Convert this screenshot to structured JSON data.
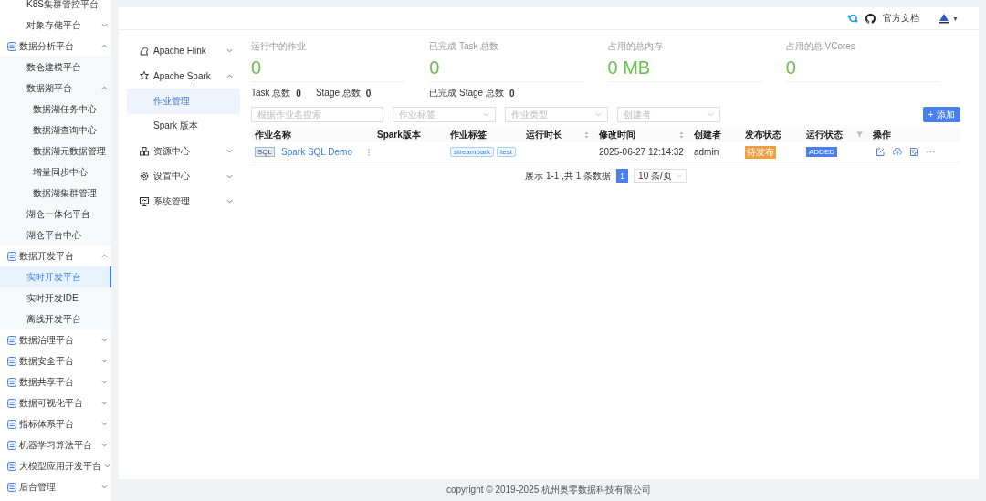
{
  "sidebar": {
    "partial_items": [
      {
        "label": "K8S集群管控平台"
      },
      {
        "label": "对象存储平台",
        "expanded": false
      }
    ],
    "items": [
      {
        "label": "数据分析平台",
        "expanded": true,
        "children": [
          {
            "label": "数仓建模平台",
            "selected": false
          },
          {
            "label": "数据湖平台",
            "expanded": true,
            "children": [
              {
                "label": "数据湖任务中心",
                "selected": false
              },
              {
                "label": "数据湖查询中心",
                "selected": false
              },
              {
                "label": "数据湖元数据管理",
                "selected": false
              },
              {
                "label": "增量同步中心",
                "selected": false
              },
              {
                "label": "数据湖集群管理",
                "selected": false
              }
            ]
          },
          {
            "label": "湖仓一体化平台",
            "selected": false
          },
          {
            "label": "湖仓平台中心",
            "selected": false
          }
        ]
      },
      {
        "label": "数据开发平台",
        "expanded": true,
        "children": [
          {
            "label": "实时开发平台",
            "selected": true
          },
          {
            "label": "实时开发IDE",
            "selected": false
          },
          {
            "label": "离线开发平台",
            "selected": false
          }
        ]
      },
      {
        "label": "数据治理平台",
        "expanded": false
      },
      {
        "label": "数据安全平台",
        "expanded": false
      },
      {
        "label": "数据共享平台",
        "expanded": false
      },
      {
        "label": "数据可视化平台",
        "expanded": false
      },
      {
        "label": "指标体系平台",
        "expanded": false
      },
      {
        "label": "机器学习算法平台",
        "expanded": false
      },
      {
        "label": "大模型应用开发平台",
        "expanded": false
      },
      {
        "label": "后台管理",
        "expanded": false
      }
    ]
  },
  "header": {
    "docs_link": "官方文档",
    "user_caret": "▼"
  },
  "submenu": {
    "items": [
      {
        "label": "Apache Flink",
        "expanded": false
      },
      {
        "label": "Apache Spark",
        "expanded": true,
        "children": [
          {
            "label": "作业管理",
            "selected": true
          },
          {
            "label": "Spark 版本",
            "selected": false
          }
        ]
      },
      {
        "label": "资源中心",
        "expanded": false
      },
      {
        "label": "设置中心",
        "expanded": false
      },
      {
        "label": "系统管理",
        "expanded": false
      }
    ]
  },
  "stats": [
    {
      "label": "运行中的作业",
      "value": "0",
      "details": [
        {
          "label": "Task 总数",
          "value": "0"
        },
        {
          "label": "Stage 总数",
          "value": "0"
        }
      ]
    },
    {
      "label": "已完成 Task 总数",
      "value": "0",
      "details": [
        {
          "label": "已完成 Stage 总数",
          "value": "0"
        }
      ]
    },
    {
      "label": "占用的总内存",
      "value": "0 MB"
    },
    {
      "label": "占用的总 VCores",
      "value": "0"
    }
  ],
  "filters": [
    {
      "kind": "search",
      "placeholder": "根据作业名搜索"
    },
    {
      "kind": "select",
      "placeholder": "作业标签"
    },
    {
      "kind": "select",
      "placeholder": "作业类型"
    },
    {
      "kind": "select",
      "placeholder": "创建者"
    }
  ],
  "add_button": {
    "icon": "+",
    "label": "添加"
  },
  "table": {
    "columns": [
      {
        "label": "作业名称",
        "kind": "plain"
      },
      {
        "label": "Spark版本",
        "kind": "plain"
      },
      {
        "label": "作业标签",
        "kind": "plain"
      },
      {
        "label": "运行时长",
        "kind": "sort"
      },
      {
        "label": "修改时间",
        "kind": "sort"
      },
      {
        "label": "创建者",
        "kind": "plain"
      },
      {
        "label": "发布状态",
        "kind": "plain"
      },
      {
        "label": "运行状态",
        "kind": "filter"
      },
      {
        "label": "操作",
        "kind": "plain"
      }
    ],
    "rows": [
      {
        "type_badge": "SQL",
        "name": "Spark SQL Demo",
        "tags": [
          "streampark",
          "test"
        ],
        "modified": "2025-06-27 12:14:32",
        "creator": "admin",
        "release_status": "待发布",
        "run_status": "ADDED"
      }
    ]
  },
  "pagination": {
    "summary": "展示 1-1 ,共 1 条数据",
    "pages": [
      {
        "label": "1",
        "selected": true
      }
    ],
    "page_size": "10 条/页"
  },
  "footer": {
    "copyright": "copyright © 2019-2025 杭州奥零数据科技有限公司"
  }
}
